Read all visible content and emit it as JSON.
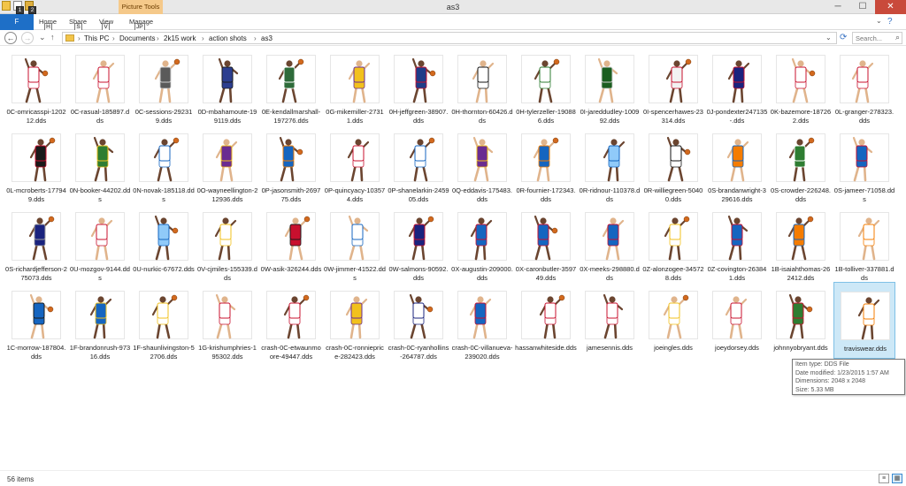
{
  "window": {
    "title": "as3",
    "contextual_tab": "Picture Tools",
    "controls": {
      "minimize": "─",
      "maximize": "☐",
      "close": "✕"
    }
  },
  "quick_access": {
    "keytips": [
      "1",
      "2"
    ]
  },
  "ribbon": {
    "file_tab": "F",
    "tabs": [
      {
        "label": "Home",
        "keytip": "H"
      },
      {
        "label": "Share",
        "keytip": "S"
      },
      {
        "label": "View",
        "keytip": "V"
      },
      {
        "label": "Manage",
        "keytip": "JP"
      }
    ],
    "help_icon": "?"
  },
  "address": {
    "back_icon": "back-arrow-icon",
    "up_icon": "up-arrow-icon",
    "crumbs": [
      "This PC",
      "Documents",
      "2k15 work",
      "action shots",
      "as3"
    ],
    "search_placeholder": "Search..."
  },
  "files": [
    {
      "name": "0C-omricasspi-120212.dds",
      "jersey": "#ffffff",
      "trim": "#c8102e"
    },
    {
      "name": "0C-rasual-185897.dds",
      "jersey": "#ffffff",
      "trim": "#c8102e"
    },
    {
      "name": "0C-sessions-292319.dds",
      "jersey": "#5a5a5a",
      "trim": "#d0d0d0"
    },
    {
      "name": "0D-mbahamoute-199119.dds",
      "jersey": "#2c3e8f",
      "trim": "#1c1c1c"
    },
    {
      "name": "0E-kendallmarshall-197276.dds",
      "jersey": "#2e6b3a",
      "trim": "#ffffff"
    },
    {
      "name": "0G-mikemiller-27311.dds",
      "jersey": "#f2c11d",
      "trim": "#6a2c91"
    },
    {
      "name": "0H-jeffgreen-38907.dds",
      "jersey": "#1f3c88",
      "trim": "#c8102e"
    },
    {
      "name": "0H-thornton-60426.dds",
      "jersey": "#ffffff",
      "trim": "#111111"
    },
    {
      "name": "0H-tylerzeller-190886.dds",
      "jersey": "#ffffff",
      "trim": "#2e7d32"
    },
    {
      "name": "0I-jareddudley-100992.dds",
      "jersey": "#1b5e20",
      "trim": "#d0d0d0"
    },
    {
      "name": "0I-spencerhawes-23314.dds",
      "jersey": "#f2f2f2",
      "trim": "#c8102e"
    },
    {
      "name": "0J-pondexter247135-.dds",
      "jersey": "#1a237e",
      "trim": "#c8102e"
    },
    {
      "name": "0K-bazemore-187262.dds",
      "jersey": "#ffffff",
      "trim": "#c8102e"
    },
    {
      "name": "0L-granger-278323.dds",
      "jersey": "#ffffff",
      "trim": "#c8102e"
    },
    {
      "name": "0L-mcroberts-177949.dds",
      "jersey": "#1a1a1a",
      "trim": "#c8102e"
    },
    {
      "name": "0N-booker-44202.dds",
      "jersey": "#2e7d32",
      "trim": "#f2c11d"
    },
    {
      "name": "0N-novak-185118.dds",
      "jersey": "#ffffff",
      "trim": "#1565c0"
    },
    {
      "name": "0O-wayneellington-212936.dds",
      "jersey": "#6a2c91",
      "trim": "#f2c11d"
    },
    {
      "name": "0P-jasonsmith-269775.dds",
      "jersey": "#1565c0",
      "trim": "#f57c00"
    },
    {
      "name": "0P-quincyacy-103574.dds",
      "jersey": "#ffffff",
      "trim": "#c8102e"
    },
    {
      "name": "0P-shanelarkin-245905.dds",
      "jersey": "#ffffff",
      "trim": "#1565c0"
    },
    {
      "name": "0Q-eddavis-175483.dds",
      "jersey": "#6a2c91",
      "trim": "#f2c11d"
    },
    {
      "name": "0R-fournier-172343.dds",
      "jersey": "#1565c0",
      "trim": "#f57c00"
    },
    {
      "name": "0R-ridnour-110378.dds",
      "jersey": "#90caf9",
      "trim": "#1565c0"
    },
    {
      "name": "0R-williegreen-50400.dds",
      "jersey": "#ffffff",
      "trim": "#111111"
    },
    {
      "name": "0S-brandanwright-329616.dds",
      "jersey": "#f57c00",
      "trim": "#1565c0"
    },
    {
      "name": "0S-crowder-226248.dds",
      "jersey": "#2e7d32",
      "trim": "#ffffff"
    },
    {
      "name": "0S-jameer-71058.dds",
      "jersey": "#1565c0",
      "trim": "#c8102e"
    },
    {
      "name": "0S-richardjefferson-275073.dds",
      "jersey": "#1a237e",
      "trim": "#9e9e9e"
    },
    {
      "name": "0U-mozgov-9144.dds",
      "jersey": "#ffffff",
      "trim": "#c8102e"
    },
    {
      "name": "0U-nurkic-67672.dds",
      "jersey": "#90caf9",
      "trim": "#1565c0"
    },
    {
      "name": "0V-cjmiles-155339.dds",
      "jersey": "#ffffff",
      "trim": "#f2c11d"
    },
    {
      "name": "0W-asik-326244.dds",
      "jersey": "#c8102e",
      "trim": "#1a1a1a"
    },
    {
      "name": "0W-jimmer-41522.dds",
      "jersey": "#ffffff",
      "trim": "#1565c0"
    },
    {
      "name": "0W-salmons-90592.dds",
      "jersey": "#1a237e",
      "trim": "#c8102e"
    },
    {
      "name": "0X-augustin-209000.dds",
      "jersey": "#1565c0",
      "trim": "#c8102e"
    },
    {
      "name": "0X-caronbutler-359749.dds",
      "jersey": "#1565c0",
      "trim": "#c8102e"
    },
    {
      "name": "0X-meeks-298880.dds",
      "jersey": "#1565c0",
      "trim": "#c8102e"
    },
    {
      "name": "0Z-alonzogee-345728.dds",
      "jersey": "#ffffff",
      "trim": "#f2c11d"
    },
    {
      "name": "0Z-covington-263841.dds",
      "jersey": "#1565c0",
      "trim": "#c8102e"
    },
    {
      "name": "1B-isaiahthomas-262412.dds",
      "jersey": "#f57c00",
      "trim": "#1565c0"
    },
    {
      "name": "1B-tolliver-337881.dds",
      "jersey": "#ffffff",
      "trim": "#f57c00"
    },
    {
      "name": "1C-morrow-187804.dds",
      "jersey": "#1565c0",
      "trim": "#1a1a1a"
    },
    {
      "name": "1F-brandonrush-97316.dds",
      "jersey": "#1565c0",
      "trim": "#f2c11d"
    },
    {
      "name": "1F-shaunlivingston-52706.dds",
      "jersey": "#ffffff",
      "trim": "#f2c11d"
    },
    {
      "name": "1G-krishumphries-195302.dds",
      "jersey": "#ffffff",
      "trim": "#c8102e"
    },
    {
      "name": "crash-0C-etwaunmoore-49447.dds",
      "jersey": "#ffffff",
      "trim": "#c8102e"
    },
    {
      "name": "crash-0C-ronnieprice-282423.dds",
      "jersey": "#f2c11d",
      "trim": "#6a2c91"
    },
    {
      "name": "crash-0C-ryanhollins-264787.dds",
      "jersey": "#ffffff",
      "trim": "#1a237e"
    },
    {
      "name": "crash-0C-villanueva-239020.dds",
      "jersey": "#1565c0",
      "trim": "#c8102e"
    },
    {
      "name": "hassanwhiteside.dds",
      "jersey": "#ffffff",
      "trim": "#c8102e"
    },
    {
      "name": "jamesennis.dds",
      "jersey": "#ffffff",
      "trim": "#c8102e"
    },
    {
      "name": "joeingles.dds",
      "jersey": "#ffffff",
      "trim": "#f2c11d"
    },
    {
      "name": "joeydorsey.dds",
      "jersey": "#ffffff",
      "trim": "#c8102e"
    },
    {
      "name": "johnnyobryant.dds",
      "jersey": "#2e7d32",
      "trim": "#c8102e"
    },
    {
      "name": "traviswear.dds",
      "jersey": "#ffffff",
      "trim": "#f57c00"
    }
  ],
  "tooltip": {
    "type": "Item type: DDS File",
    "modified": "Date modified: 1/23/2015 1:57 AM",
    "dimensions": "Dimensions: 2048 x 2048",
    "size": "Size: 5.33 MB"
  },
  "status": {
    "item_count": "56 items",
    "view_details_icon": "details-view-icon",
    "view_large_icon": "large-icons-view-icon"
  }
}
